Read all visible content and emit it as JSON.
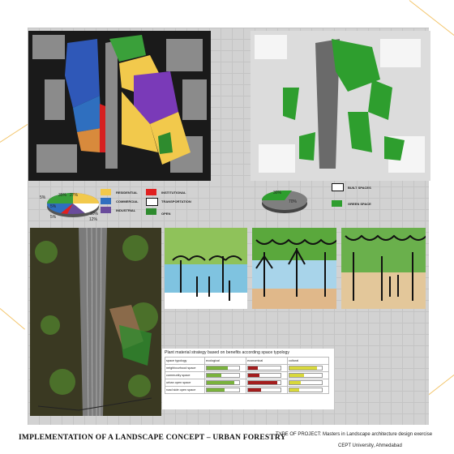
{
  "pie_land_use": {
    "labels": [
      "5%",
      "35%",
      "27%",
      "5%",
      "10%",
      "5%",
      "12%"
    ]
  },
  "land_use_legend": {
    "residential": "RESIDENTIAL",
    "commercial": "COMMERCIAL",
    "industrial": "INDUSTRIAL",
    "institutional": "INSTITUTIONAL",
    "transportation": "TRANSPORTATION",
    "open": "OPEN"
  },
  "colors": {
    "residential": "#f2c94c",
    "commercial": "#2f6fbf",
    "industrial": "#6a4c9c",
    "institutional": "#e02020",
    "transportation": "#ffffff",
    "open": "#2e8b2e",
    "green_space": "#2e9e2e",
    "built": "#7f7f7f"
  },
  "pie_built_green": {
    "labels": [
      "30%",
      "70%"
    ]
  },
  "built_legend": {
    "built": "BUILT SPACES",
    "green": "GREEN SPACE"
  },
  "strategy": {
    "title": "Plant material strategy based on benefits according space typology",
    "headers": [
      "space typology",
      "ecological",
      "economical",
      "cultural"
    ],
    "rows": [
      "neighbourhood space",
      "community space",
      "urban open space",
      "road side open space"
    ],
    "ecological_fill": [
      0.65,
      0.45,
      0.85,
      0.55
    ],
    "economical_fill": [
      0.3,
      0.35,
      0.9,
      0.4
    ],
    "cultural_fill": [
      0.85,
      0.45,
      0.35,
      0.3
    ]
  },
  "footer": {
    "title": "IMPLEMENTATION OF A LANDSCAPE CONCEPT – URBAN FORESTRY",
    "project": "TYPE OF PROJECT: Masters in Landscape architecture design exercise",
    "institution": "CEPT  University, Ahmedabad"
  }
}
